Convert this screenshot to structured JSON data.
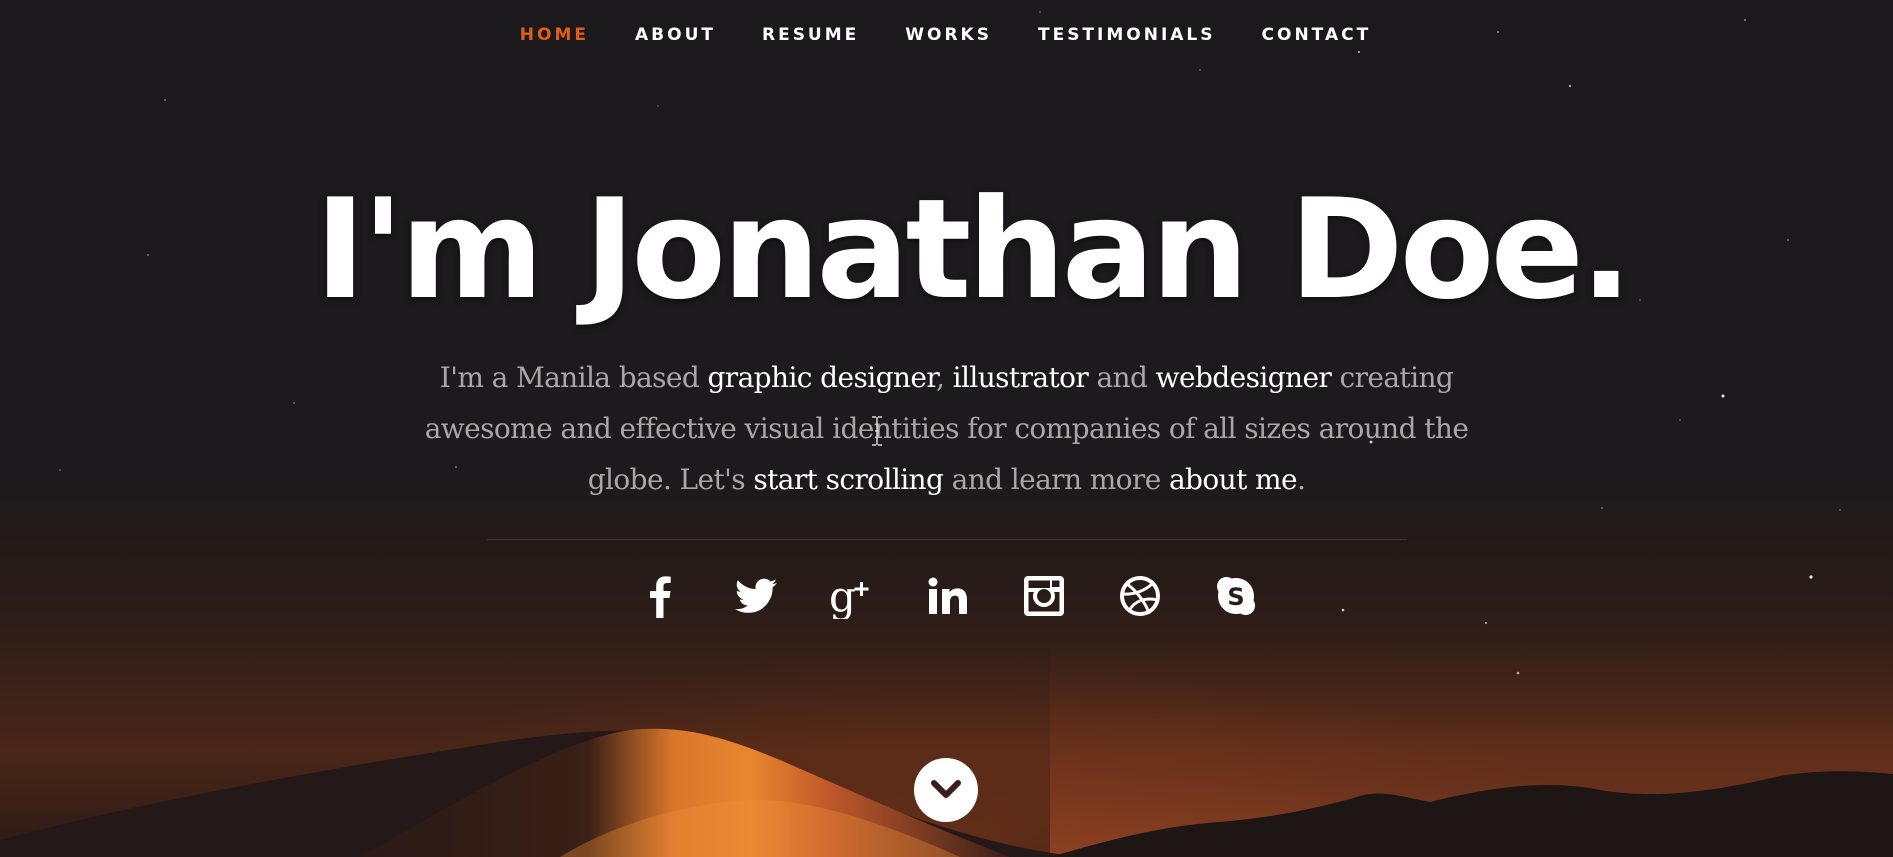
{
  "nav": {
    "items": [
      {
        "label": "HOME",
        "current": true
      },
      {
        "label": "ABOUT"
      },
      {
        "label": "RESUME"
      },
      {
        "label": "WORKS"
      },
      {
        "label": "TESTIMONIALS"
      },
      {
        "label": "CONTACT"
      }
    ],
    "accent_color": "#e05d1a"
  },
  "banner": {
    "headline": "I'm Jonathan Doe.",
    "intro": {
      "p1": "I'm a Manila based ",
      "l1": "graphic designer",
      "p2": ", ",
      "l2": "illustrator",
      "p3": " and ",
      "l3": "webdesigner",
      "p4": " creating awesome and effective visual identities for companies of all sizes around the globe. Let's ",
      "l4": "start scrolling",
      "p5": " and learn more ",
      "l5": "about me",
      "p6": "."
    }
  },
  "social": {
    "icons": [
      "facebook-icon",
      "twitter-icon",
      "google-plus-icon",
      "linkedin-icon",
      "instagram-icon",
      "dribbble-icon",
      "skype-icon"
    ]
  },
  "scroll_down": {
    "icon": "chevron-down-icon"
  }
}
